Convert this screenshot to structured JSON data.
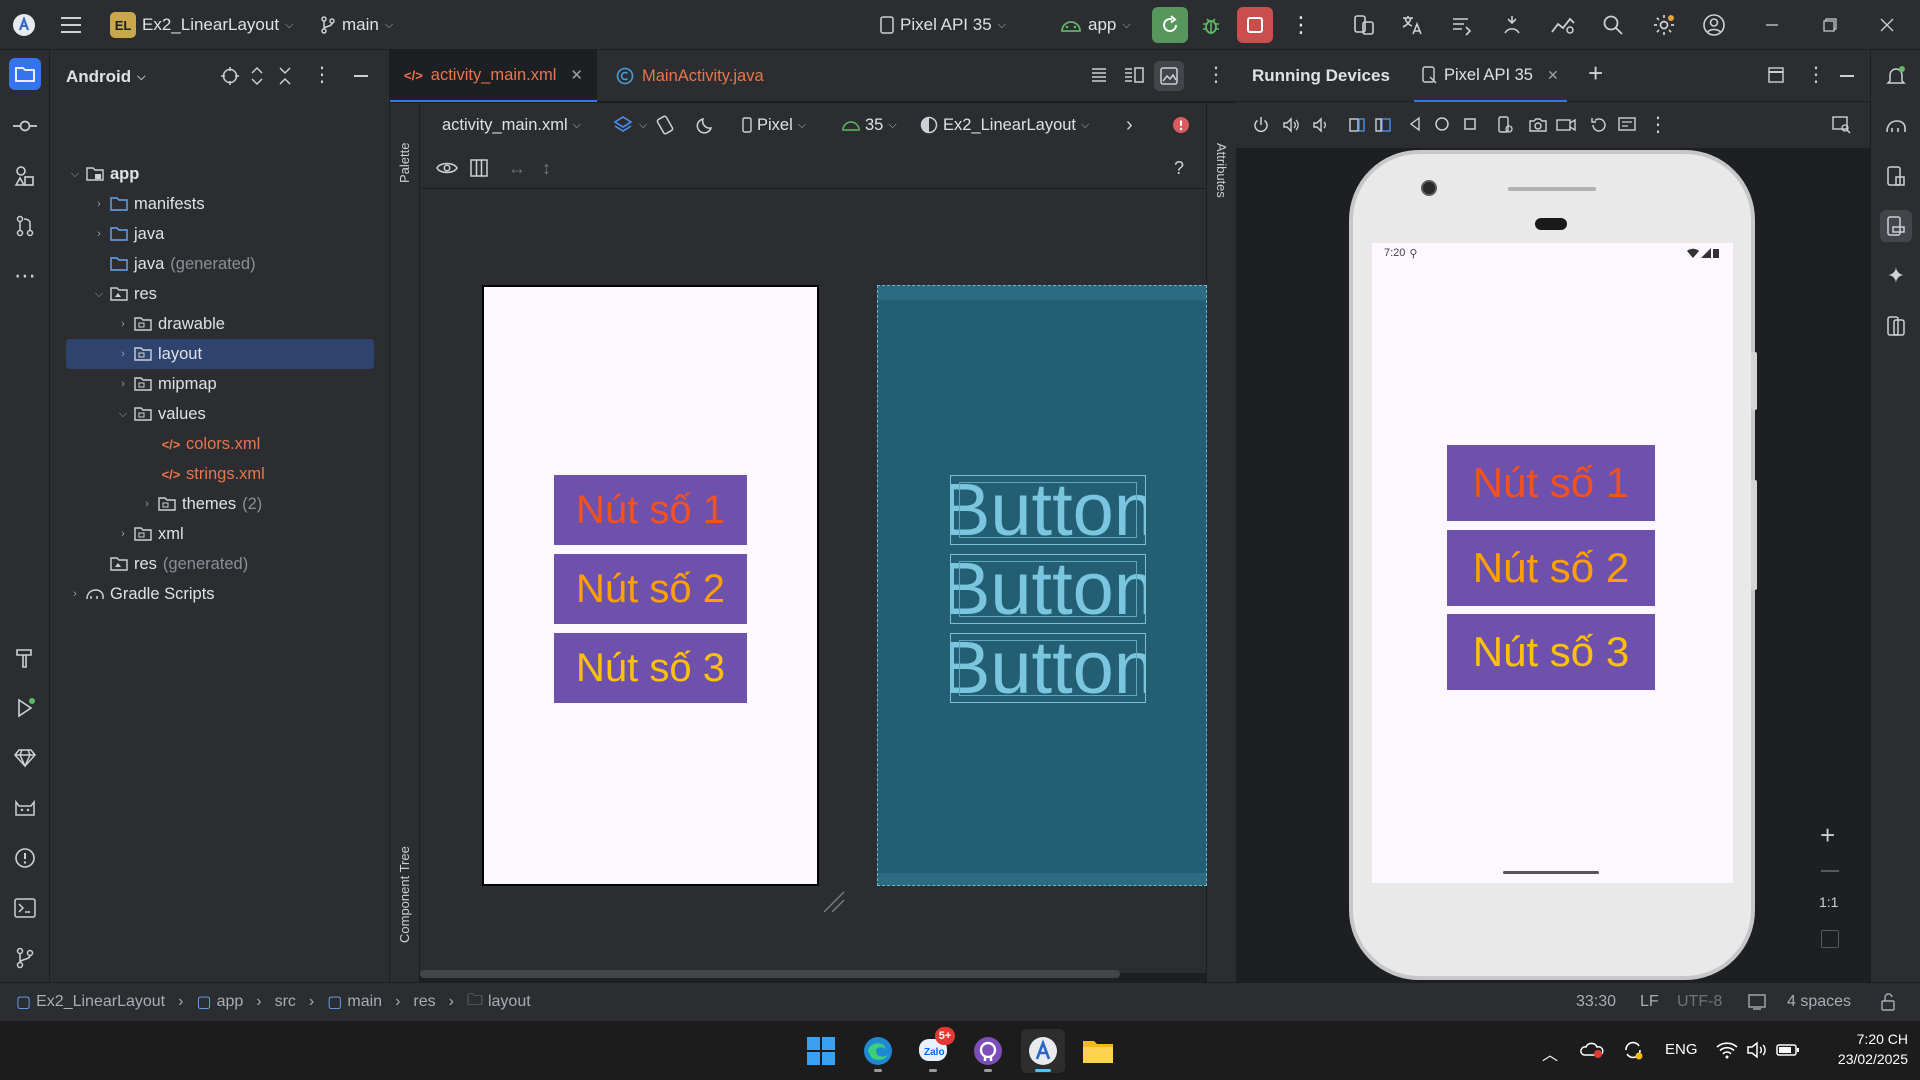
{
  "titlebar": {
    "project_badge": "EL",
    "project_name": "Ex2_LinearLayout",
    "branch": "main",
    "device": "Pixel API 35",
    "run_config": "app"
  },
  "project_panel": {
    "view_mode": "Android",
    "tree": [
      {
        "label": "app",
        "extra": ""
      },
      {
        "label": "manifests",
        "extra": ""
      },
      {
        "label": "java",
        "extra": ""
      },
      {
        "label": "java",
        "extra": "(generated)"
      },
      {
        "label": "res",
        "extra": ""
      },
      {
        "label": "drawable",
        "extra": ""
      },
      {
        "label": "layout",
        "extra": ""
      },
      {
        "label": "mipmap",
        "extra": ""
      },
      {
        "label": "values",
        "extra": ""
      },
      {
        "label": "colors.xml",
        "extra": ""
      },
      {
        "label": "strings.xml",
        "extra": ""
      },
      {
        "label": "themes",
        "extra": "(2)"
      },
      {
        "label": "xml",
        "extra": ""
      },
      {
        "label": "res",
        "extra": "(generated)"
      },
      {
        "label": "Gradle Scripts",
        "extra": ""
      }
    ]
  },
  "editor": {
    "tabs": [
      "activity_main.xml",
      "MainActivity.java"
    ],
    "palette_label": "Palette",
    "component_tree_label": "Component Tree",
    "attributes_label": "Attributes",
    "toolbar": {
      "file": "activity_main.xml",
      "device": "Pixel",
      "api": "35",
      "theme": "Ex2_LinearLayout"
    },
    "help": "?",
    "design_buttons": [
      {
        "text": "Nút số 1",
        "color": "#f4511e"
      },
      {
        "text": "Nút số 2",
        "color": "#ffa000"
      },
      {
        "text": "Nút số 3",
        "color": "#ffc107"
      }
    ],
    "blueprint_buttons": [
      "Button",
      "Button",
      "Button"
    ]
  },
  "running_devices": {
    "title": "Running Devices",
    "device_tab": "Pixel API 35",
    "status_time": "7:20",
    "buttons": [
      {
        "text": "Nút số 1",
        "color": "#f4511e"
      },
      {
        "text": "Nút số 2",
        "color": "#ffa000"
      },
      {
        "text": "Nút số 3",
        "color": "#ffc107"
      }
    ],
    "zoom_reset": "1:1"
  },
  "statusbar": {
    "breadcrumb": [
      "Ex2_LinearLayout",
      "app",
      "src",
      "main",
      "res",
      "layout"
    ],
    "position": "33:30",
    "line_sep": "LF",
    "encoding": "UTF-8",
    "indent": "4 spaces"
  },
  "taskbar": {
    "zalo_badge": "5+",
    "lang": "ENG",
    "time": "7:20 CH",
    "date": "23/02/2025"
  }
}
